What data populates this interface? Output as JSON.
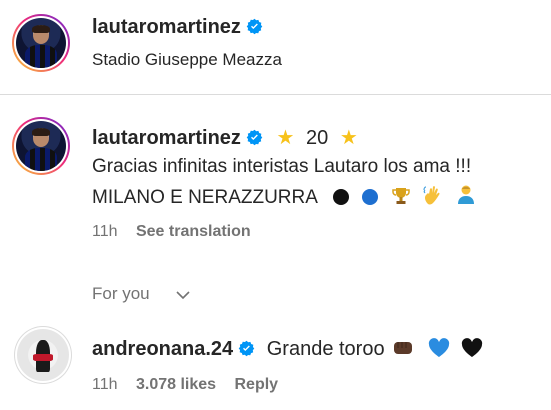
{
  "post_header": {
    "username": "lautaromartinez",
    "location": "Stadio Giuseppe Meazza"
  },
  "caption": {
    "username": "lautaromartinez",
    "number": "20",
    "line1": "Gracias infinitas interistas Lautaro los ama !!!",
    "line2": "MILANO E NERAZZURRA",
    "time": "11h",
    "see_translation": "See translation"
  },
  "section": {
    "label": "For you"
  },
  "comment": {
    "username": "andreonana.24",
    "text": "Grande toroo",
    "time": "11h",
    "likes": "3.078 likes",
    "reply": "Reply"
  },
  "colors": {
    "verified": "#0095f6",
    "star": "#f7c21b",
    "muted": "#737373",
    "text": "#262626"
  }
}
